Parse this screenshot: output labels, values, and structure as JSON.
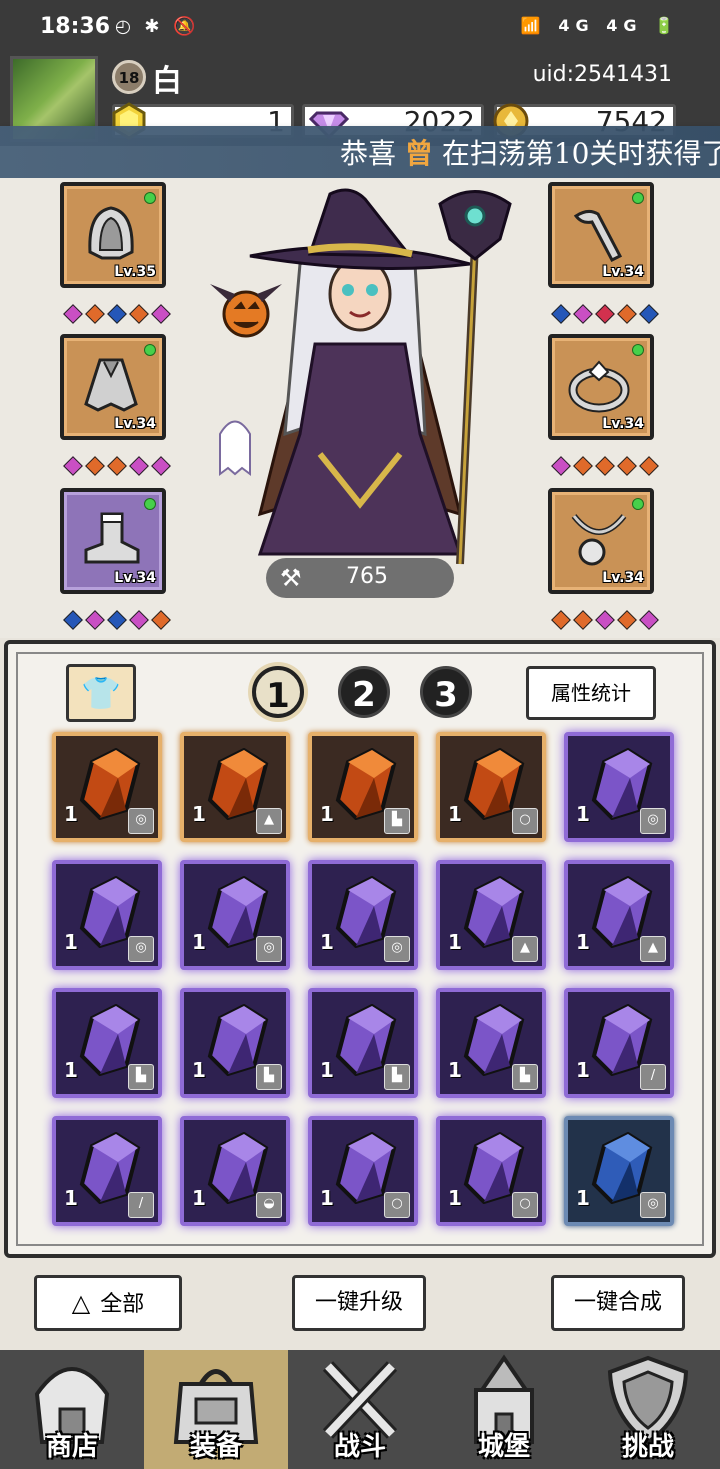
{
  "status": {
    "time": "18:36",
    "left_icons": "◴ ✱ 🔕",
    "right_icons": "📶 4G 4G 🔋"
  },
  "player": {
    "level": "18",
    "name": "白",
    "uid": "uid:2541431"
  },
  "resources": [
    {
      "name": "gold-gem",
      "value": "1"
    },
    {
      "name": "diamond",
      "value": "2022"
    },
    {
      "name": "coin",
      "value": "7542"
    }
  ],
  "banner": {
    "prefix": "恭喜",
    "highlight": "曾",
    "suffix": "在扫荡第10关时获得了"
  },
  "equipment": {
    "left": [
      {
        "name": "hood",
        "level": "Lv.35",
        "rarity": "orange",
        "gems": [
          "#c94fc4",
          "#e06a2a",
          "#2557b8",
          "#e06a2a",
          "#c94fc4"
        ]
      },
      {
        "name": "cloak",
        "level": "Lv.34",
        "rarity": "orange",
        "gems": [
          "#c94fc4",
          "#e06a2a",
          "#e06a2a",
          "#c94fc4",
          "#c94fc4"
        ]
      },
      {
        "name": "boots",
        "level": "Lv.34",
        "rarity": "purple",
        "gems": [
          "#2557b8",
          "#c94fc4",
          "#2557b8",
          "#c94fc4",
          "#e06a2a"
        ]
      }
    ],
    "right": [
      {
        "name": "staff",
        "level": "Lv.34",
        "rarity": "orange",
        "gems": [
          "#2557b8",
          "#c94fc4",
          "#d2314e",
          "#e06a2a",
          "#2557b8"
        ]
      },
      {
        "name": "ring",
        "level": "Lv.34",
        "rarity": "orange",
        "gems": [
          "#c94fc4",
          "#e06a2a",
          "#e06a2a",
          "#e06a2a",
          "#e06a2a"
        ]
      },
      {
        "name": "necklace",
        "level": "Lv.34",
        "rarity": "orange",
        "gems": [
          "#e06a2a",
          "#e06a2a",
          "#c94fc4",
          "#e06a2a",
          "#c94fc4"
        ]
      }
    ]
  },
  "power": {
    "value": "765"
  },
  "inventory": {
    "tabs": [
      "1",
      "2",
      "3"
    ],
    "active_tab": 0,
    "attr_button": "属性统计",
    "items": [
      {
        "rarity": "orange",
        "count": "1",
        "type": "hood"
      },
      {
        "rarity": "orange",
        "count": "1",
        "type": "cloak"
      },
      {
        "rarity": "orange",
        "count": "1",
        "type": "boots"
      },
      {
        "rarity": "orange",
        "count": "1",
        "type": "ring"
      },
      {
        "rarity": "purple",
        "count": "1",
        "type": "hood"
      },
      {
        "rarity": "purple",
        "count": "1",
        "type": "hood"
      },
      {
        "rarity": "purple",
        "count": "1",
        "type": "hood"
      },
      {
        "rarity": "purple",
        "count": "1",
        "type": "hood"
      },
      {
        "rarity": "purple",
        "count": "1",
        "type": "cloak"
      },
      {
        "rarity": "purple",
        "count": "1",
        "type": "cloak"
      },
      {
        "rarity": "purple",
        "count": "1",
        "type": "boots"
      },
      {
        "rarity": "purple",
        "count": "1",
        "type": "boots"
      },
      {
        "rarity": "purple",
        "count": "1",
        "type": "boots"
      },
      {
        "rarity": "purple",
        "count": "1",
        "type": "boots"
      },
      {
        "rarity": "purple",
        "count": "1",
        "type": "staff"
      },
      {
        "rarity": "purple",
        "count": "1",
        "type": "staff"
      },
      {
        "rarity": "purple",
        "count": "1",
        "type": "helmet"
      },
      {
        "rarity": "purple",
        "count": "1",
        "type": "ring"
      },
      {
        "rarity": "purple",
        "count": "1",
        "type": "ring"
      },
      {
        "rarity": "blue",
        "count": "1",
        "type": "hood"
      }
    ]
  },
  "actions": {
    "filter_all": "全部",
    "upgrade_all": "一键升级",
    "merge_all": "一键合成"
  },
  "nav": [
    {
      "label": "商店",
      "icon": "shop-icon"
    },
    {
      "label": "装备",
      "icon": "bag-icon"
    },
    {
      "label": "战斗",
      "icon": "swords-icon"
    },
    {
      "label": "城堡",
      "icon": "castle-icon"
    },
    {
      "label": "挑战",
      "icon": "shield-icon"
    }
  ]
}
